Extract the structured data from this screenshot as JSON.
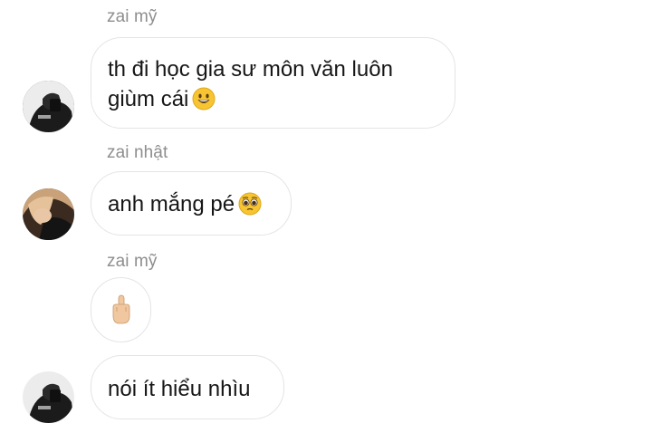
{
  "messages": [
    {
      "sender": "zai mỹ",
      "text": "th đi học gia sư môn văn luôn giùm cái",
      "emoji": "grinning-face"
    },
    {
      "sender": "zai nhật",
      "text": "anh mắng pé",
      "emoji": "pleading-face"
    },
    {
      "sender": "zai mỹ",
      "emoji": "middle-finger"
    },
    {
      "text": "nói ít hiểu nhìu"
    }
  ],
  "colors": {
    "sender_text": "#8e8e8e",
    "bubble_border": "#e4e4e4",
    "emoji_yellow": "#f7c531",
    "skin": "#f0c79f"
  }
}
